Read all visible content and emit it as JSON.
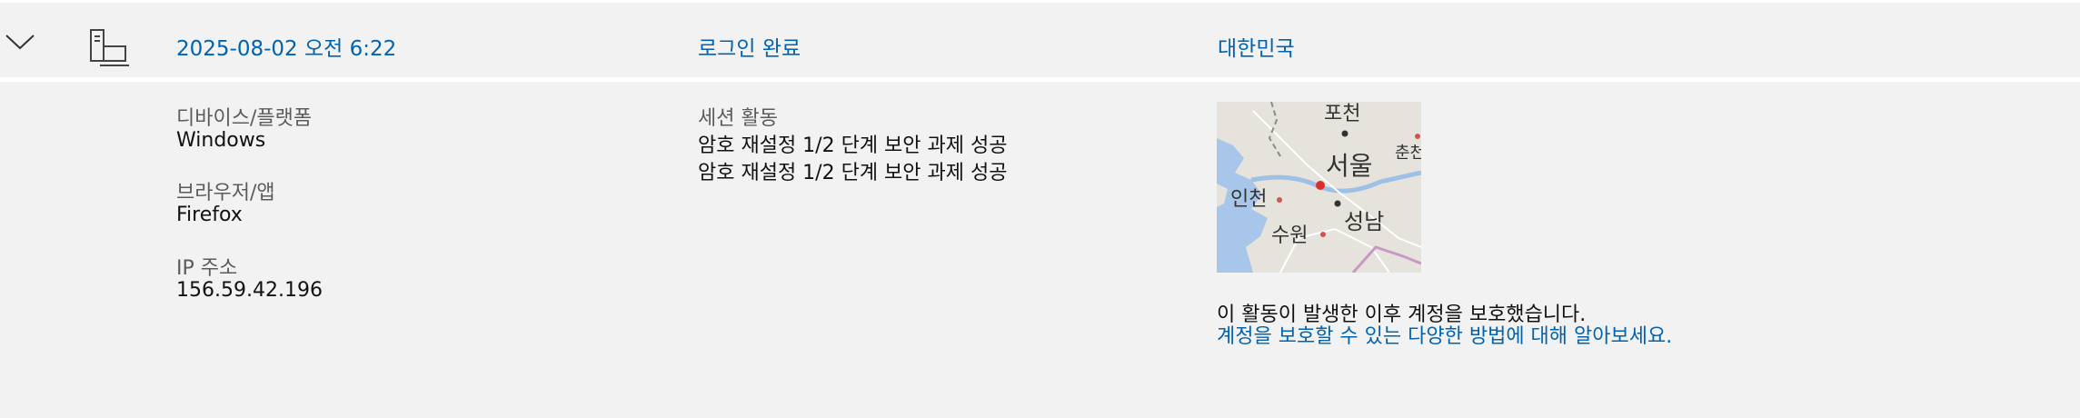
{
  "entry": {
    "datetime": "2025-08-02 오전 6:22",
    "status": "로그인 완료",
    "country": "대한민국"
  },
  "device": {
    "platform_label": "디바이스/플랫폼",
    "platform_value": "Windows",
    "browser_label": "브라우저/앱",
    "browser_value": "Firefox",
    "ip_label": "IP 주소",
    "ip_value": "156.59.42.196"
  },
  "session": {
    "label": "세션 활동",
    "activities": [
      "암호 재설정 1/2 단계 보안 과제 성공",
      "암호 재설정 1/2 단계 보안 과제 성공"
    ]
  },
  "map": {
    "labels": [
      "포천",
      "서울",
      "춘천",
      "인천",
      "성남",
      "수원"
    ]
  },
  "protection": {
    "note": "이 활동이 발생한 이후 계정을 보호했습니다.",
    "link": "계정을 보호할 수 있는 다양한 방법에 대해 알아보세요."
  },
  "colors": {
    "link": "#0063b1",
    "background": "#f2f2f2",
    "map_water": "#a8c6ea",
    "map_land": "#e6e3dc"
  },
  "icons": [
    "chevron-down-icon",
    "device-pc-icon",
    "map-pin-icon"
  ]
}
